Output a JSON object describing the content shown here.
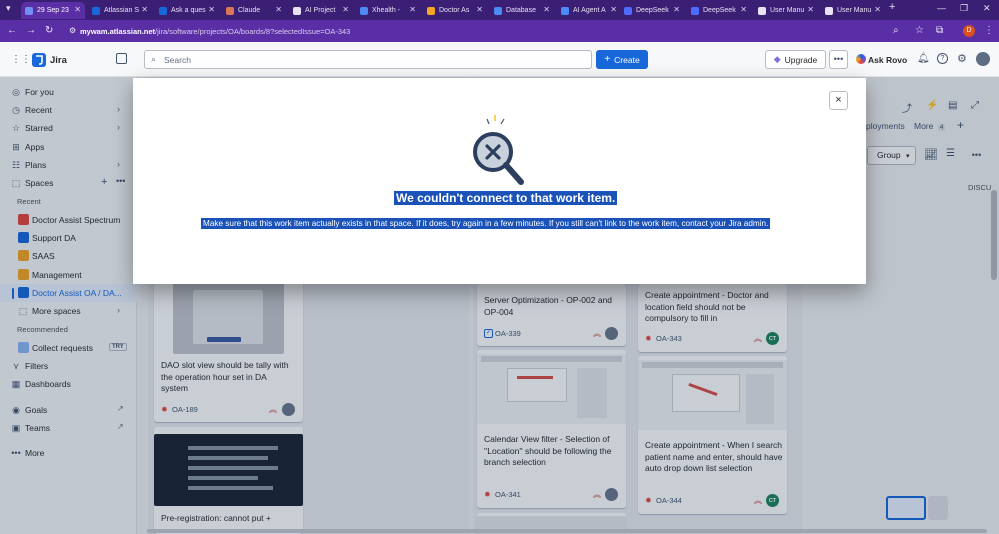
{
  "browser": {
    "tabs": [
      {
        "label": "29 Sep 23",
        "active": true
      },
      {
        "label": "Atlassian S"
      },
      {
        "label": "Ask a ques"
      },
      {
        "label": "Claude"
      },
      {
        "label": "AI Project"
      },
      {
        "label": "Xhealth - "
      },
      {
        "label": "Doctor As"
      },
      {
        "label": "Database"
      },
      {
        "label": "AI Agent A"
      },
      {
        "label": "DeepSeek"
      },
      {
        "label": "DeepSeek"
      },
      {
        "label": "User Manu"
      },
      {
        "label": "User Manu"
      }
    ],
    "new_tab": "+",
    "url_host": "mywam.atlassian.net",
    "url_path": "/jira/software/projects/OA/boards/8?selectedIssue=OA-343"
  },
  "header": {
    "app_name": "Jira",
    "search_placeholder": "Search",
    "create_label": "Create",
    "upgrade_label": "Upgrade",
    "rovo_label": "Ask Rovo",
    "profile_initial": "D"
  },
  "sidebar": {
    "for_you": "For you",
    "recent": "Recent",
    "starred": "Starred",
    "apps": "Apps",
    "plans": "Plans",
    "spaces": "Spaces",
    "recent_section": "Recent",
    "projects": [
      {
        "label": "Doctor Assist Spectrum",
        "color": "#e2483d"
      },
      {
        "label": "Support DA",
        "color": "#1868db"
      },
      {
        "label": "SAAS",
        "color": "#f5a623"
      },
      {
        "label": "Management",
        "color": "#f5a623"
      },
      {
        "label": "Doctor Assist OA / DA...",
        "color": "#1868db"
      }
    ],
    "more_spaces": "More spaces",
    "recommended_section": "Recommended",
    "collect_requests": "Collect requests",
    "try_badge": "TRY",
    "filters": "Filters",
    "dashboards": "Dashboards",
    "goals": "Goals",
    "teams": "Teams",
    "more": "More"
  },
  "board": {
    "deployments_tab": "ployments",
    "more_tab": "More",
    "more_count": "4",
    "group_label": "Group",
    "discuss_label": "DISCU",
    "cards": [
      {
        "title": "DAO slot view should be tally with the operation hour set in DA system",
        "key": "OA-189"
      },
      {
        "title": "Pre-registration: cannot put +",
        "key": ""
      },
      {
        "title": "Server Optimization - OP-002 and OP-004",
        "key": "OA-339"
      },
      {
        "title": "Calendar View filter - Selection of ''Location'' should be following the branch selection",
        "key": "OA-341"
      },
      {
        "title": "Create appointment - Doctor and location field should not be compulsory to fill in",
        "key": "OA-343",
        "assignee": "CT"
      },
      {
        "title": "Create appointment - When I search patient name and enter, should have auto drop down list selection",
        "key": "OA-344",
        "assignee": "CT"
      }
    ]
  },
  "modal": {
    "title": "We couldn't connect to that work item.",
    "body": "Make sure that this work item actually exists in that space. If it does, try again in a few minutes. If you still can't link to the work item, contact your Jira admin.",
    "close_icon": "×"
  }
}
